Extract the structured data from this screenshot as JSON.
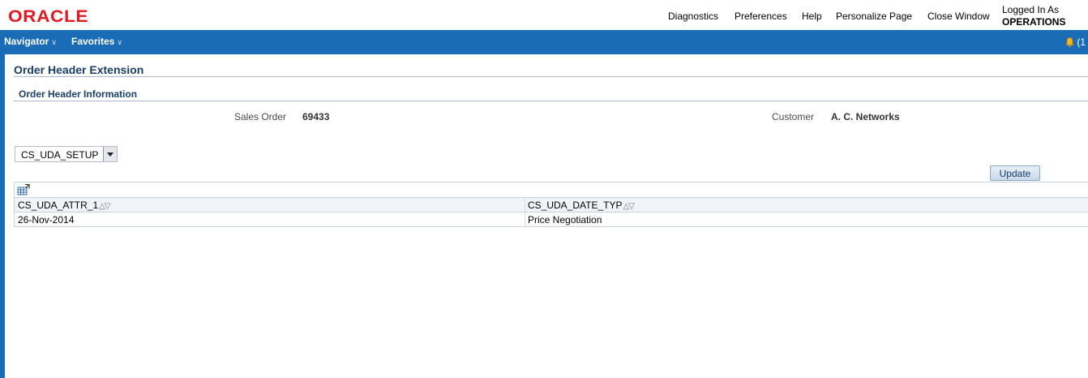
{
  "header": {
    "logo": "ORACLE",
    "links": [
      "Diagnostics",
      "Preferences",
      "Help",
      "Personalize Page",
      "Close Window"
    ],
    "logged_in_label": "Logged In As",
    "logged_in_user": "OPERATIONS"
  },
  "nav": {
    "items": [
      "Navigator",
      "Favorites"
    ],
    "notification_count": "(1"
  },
  "page": {
    "title": "Order Header Extension",
    "section_title": "Order Header Information",
    "sales_order_label": "Sales Order",
    "sales_order_value": "69433",
    "customer_label": "Customer",
    "customer_value": "A. C. Networks",
    "attribute_group_selected": "CS_UDA_SETUP",
    "update_label": "Update"
  },
  "table": {
    "columns": [
      "CS_UDA_ATTR_1",
      "CS_UDA_DATE_TYP"
    ],
    "rows": [
      [
        "26-Nov-2014",
        "Price Negotiation"
      ]
    ]
  },
  "colors": {
    "brand_red": "#e21a22",
    "nav_blue": "#1b6cb6",
    "title_blue": "#1a3e66"
  }
}
